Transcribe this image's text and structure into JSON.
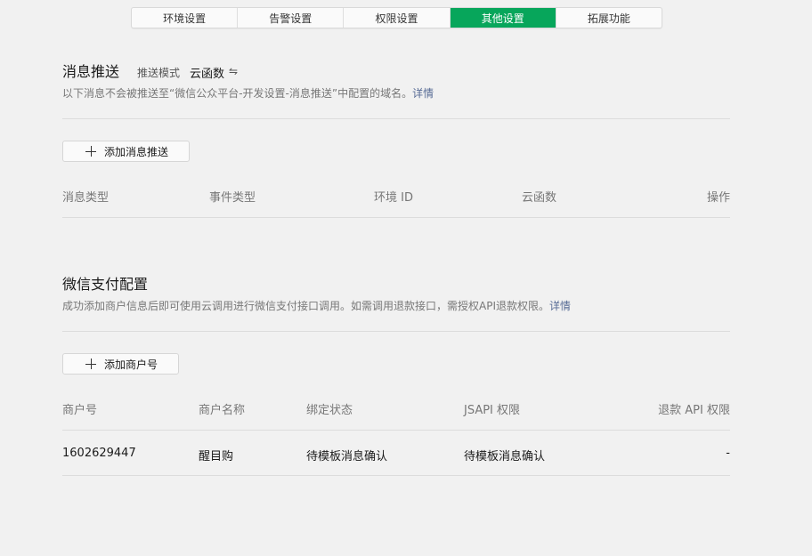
{
  "tabs": [
    {
      "label": "环境设置",
      "active": false
    },
    {
      "label": "告警设置",
      "active": false
    },
    {
      "label": "权限设置",
      "active": false
    },
    {
      "label": "其他设置",
      "active": true
    },
    {
      "label": "拓展功能",
      "active": false
    }
  ],
  "push": {
    "title": "消息推送",
    "mode_label": "推送模式",
    "mode_value": "云函数",
    "mode_switch_icon": "⇋",
    "description": "以下消息不会被推送至“微信公众平台-开发设置-消息推送”中配置的域名。",
    "detail_link": "详情",
    "add_button": "添加消息推送",
    "columns": [
      "消息类型",
      "事件类型",
      "环境 ID",
      "云函数",
      "操作"
    ]
  },
  "pay": {
    "title": "微信支付配置",
    "description": "成功添加商户信息后即可使用云调用进行微信支付接口调用。如需调用退款接口，需授权API退款权限。",
    "detail_link": "详情",
    "add_button": "添加商户号",
    "columns": [
      "商户号",
      "商户名称",
      "绑定状态",
      "JSAPI 权限",
      "退款 API 权限"
    ],
    "rows": [
      {
        "merchant_id": "1602629447",
        "merchant_name": "醒目购",
        "bind_status": "待模板消息确认",
        "jsapi": "待模板消息确认",
        "refund_api": "-"
      }
    ]
  },
  "colors": {
    "accent": "#07a65b",
    "link": "#576b95"
  }
}
